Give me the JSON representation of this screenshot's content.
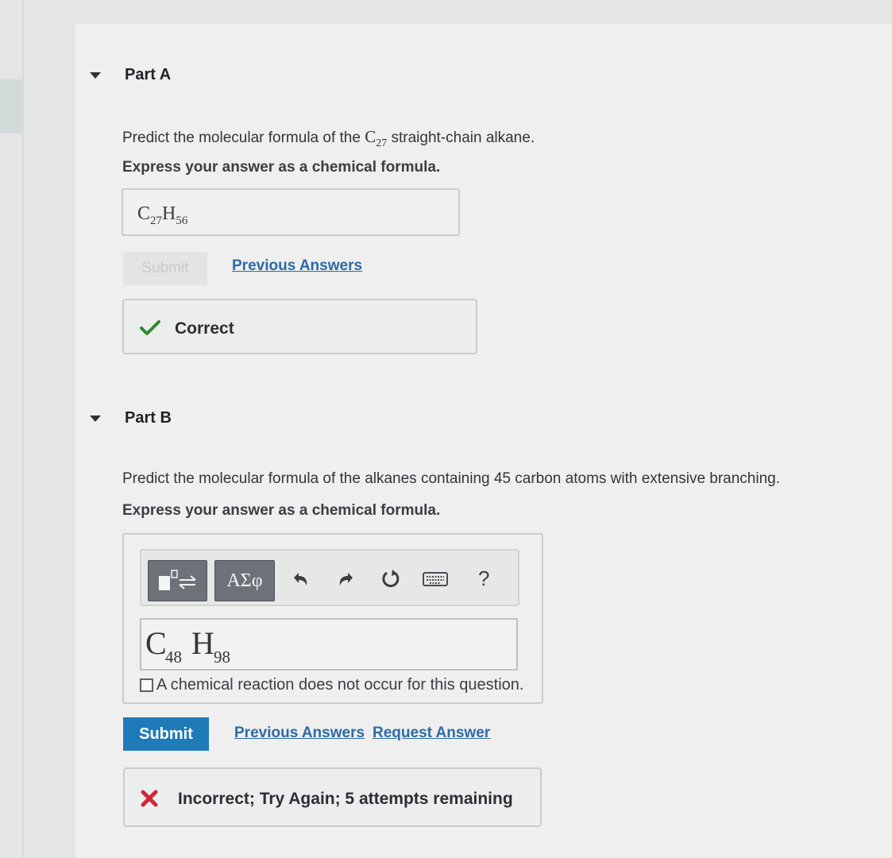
{
  "part_a": {
    "title": "Part A",
    "question_prefix": "Predict the molecular formula of the ",
    "question_element": "C",
    "question_subscript": "27",
    "question_suffix": " straight-chain alkane.",
    "instruction": "Express your answer as a chemical formula.",
    "answer": {
      "c": "C",
      "c_sub": "27",
      "h": "H",
      "h_sub": "56"
    },
    "submit_label": "Submit",
    "previous_answers_label": "Previous Answers",
    "feedback": "Correct",
    "feedback_color": "#2e8b2e"
  },
  "part_b": {
    "title": "Part B",
    "question": "Predict the molecular formula of the alkanes containing 45 carbon atoms with extensive branching.",
    "instruction": "Express your answer as a chemical formula.",
    "toolbar": {
      "template_icon": "template-arrow-icon",
      "greek_label": "ΑΣφ",
      "undo_icon": "undo-icon",
      "redo_icon": "redo-icon",
      "reset_icon": "reset-icon",
      "keyboard_icon": "keyboard-icon",
      "help_label": "?"
    },
    "input": {
      "c": "C",
      "c_sub": "48",
      "h": "H",
      "h_sub": "98"
    },
    "no_reaction_label": "A chemical reaction does not occur for this question.",
    "no_reaction_checked": false,
    "submit_label": "Submit",
    "previous_answers_label": "Previous Answers",
    "request_answer_label": "Request Answer",
    "feedback": "Incorrect; Try Again; 5 attempts remaining",
    "feedback_color": "#d0283a",
    "accent_color": "#1f7bb8"
  }
}
